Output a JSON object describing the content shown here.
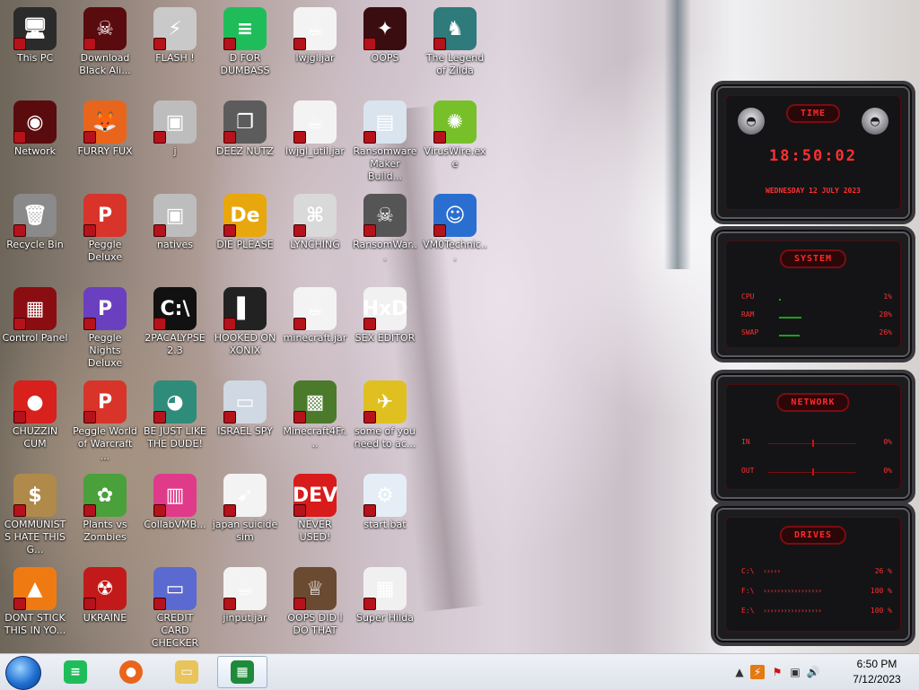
{
  "desktop": {
    "icons": [
      {
        "label": "This PC",
        "glyph": "🖥",
        "bg": "#2b2b2b"
      },
      {
        "label": "Download Black Ali...",
        "glyph": "☠",
        "bg": "#5a0b0e"
      },
      {
        "label": "FLASH !",
        "glyph": "⚡",
        "bg": "#c9c9c9"
      },
      {
        "label": "D FOR DUMBASS",
        "glyph": "≡",
        "bg": "#1fbd5a"
      },
      {
        "label": "lwjgl.jar",
        "glyph": "☕",
        "bg": "#f3f3f3"
      },
      {
        "label": "OOPS",
        "glyph": "✦",
        "bg": "#3a0d10"
      },
      {
        "label": "The Legend of Zilda",
        "glyph": "♞",
        "bg": "#2f7a7a"
      },
      {
        "label": "Network",
        "glyph": "◉",
        "bg": "#5a0b0e"
      },
      {
        "label": "FURRY FUX",
        "glyph": "🦊",
        "bg": "#e9651b"
      },
      {
        "label": "j",
        "glyph": "▣",
        "bg": "#bdbdbd"
      },
      {
        "label": "DEEZ NUTZ",
        "glyph": "❐",
        "bg": "#5c5c5c"
      },
      {
        "label": "lwjgl_util.jar",
        "glyph": "☕",
        "bg": "#f3f3f3"
      },
      {
        "label": "Ransomware Maker Build...",
        "glyph": "▤",
        "bg": "#d9e4ef"
      },
      {
        "label": "VirusWire.exe",
        "glyph": "✺",
        "bg": "#78c02a"
      },
      {
        "label": "Recycle Bin",
        "glyph": "🗑",
        "bg": "#8a8a8a"
      },
      {
        "label": "Peggle Deluxe",
        "glyph": "P",
        "bg": "#d8342a"
      },
      {
        "label": "natives",
        "glyph": "▣",
        "bg": "#bdbdbd"
      },
      {
        "label": "DIE PLEASE",
        "glyph": "De",
        "bg": "#e8a70c"
      },
      {
        "label": "LYNCHING",
        "glyph": "⌘",
        "bg": "#d9d9d9"
      },
      {
        "label": "RansomWar...",
        "glyph": "☠",
        "bg": "#555"
      },
      {
        "label": "VM0Technic...",
        "glyph": "☺",
        "bg": "#2a6fd0"
      },
      {
        "label": "Control Panel",
        "glyph": "▦",
        "bg": "#8a0d12"
      },
      {
        "label": "Peggle Nights Deluxe",
        "glyph": "P",
        "bg": "#6a3fc0"
      },
      {
        "label": "2PACALYPSE 2.3",
        "glyph": "C:\\",
        "bg": "#111"
      },
      {
        "label": "HOOKED ON XONIX",
        "glyph": "▌",
        "bg": "#222"
      },
      {
        "label": "minecraft.jar",
        "glyph": "☕",
        "bg": "#f3f3f3"
      },
      {
        "label": "SEX EDITOR",
        "glyph": "HxD",
        "bg": "#f1f1f1"
      },
      {
        "label": "CHUZZIN CUM",
        "glyph": "●",
        "bg": "#d8201c"
      },
      {
        "label": "Peggle World of Warcraft ...",
        "glyph": "P",
        "bg": "#d8342a"
      },
      {
        "label": "BE JUST LIKE THE DUDE!",
        "glyph": "◕",
        "bg": "#2f8c7a"
      },
      {
        "label": "ISRAEL SPY",
        "glyph": "▭",
        "bg": "#cfd8e3"
      },
      {
        "label": "Minecraft4Fr...",
        "glyph": "▩",
        "bg": "#4a7a2a"
      },
      {
        "label": "some of you need to ac...",
        "glyph": "✈",
        "bg": "#e0c020"
      },
      {
        "label": "COMMUNISTS HATE THIS G...",
        "glyph": "$",
        "bg": "#b08a4a"
      },
      {
        "label": "Plants vs Zombies",
        "glyph": "✿",
        "bg": "#4aa03a"
      },
      {
        "label": "CollabVMB...",
        "glyph": "▥",
        "bg": "#e03a8a"
      },
      {
        "label": "japan suicide sim",
        "glyph": "➹",
        "bg": "#f3f3f3"
      },
      {
        "label": "NEVER USED!",
        "glyph": "DEV",
        "bg": "#d81b1b"
      },
      {
        "label": "start.bat",
        "glyph": "⚙",
        "bg": "#e5eef7"
      },
      {
        "label": "DONT STICK THIS IN YO...",
        "glyph": "▲",
        "bg": "#f07a12"
      },
      {
        "label": "UKRAINE",
        "glyph": "☢",
        "bg": "#c21a1a"
      },
      {
        "label": "CREDIT CARD CHECKER",
        "glyph": "▭",
        "bg": "#5a6ad0"
      },
      {
        "label": "jinput.jar",
        "glyph": "☕",
        "bg": "#f3f3f3"
      },
      {
        "label": "OOPS DID I DO THAT",
        "glyph": "♕",
        "bg": "#6a4a30"
      },
      {
        "label": "Super Hilda",
        "glyph": "▦",
        "bg": "#f0f0f0"
      }
    ]
  },
  "gadgets": {
    "time": {
      "title": "TIME",
      "clock": "18:50:02",
      "date": "WEDNESDAY 12 JULY 2023"
    },
    "system": {
      "title": "SYSTEM",
      "rows": [
        {
          "label": "CPU",
          "value": "1%",
          "fill": 0.01
        },
        {
          "label": "RAM",
          "value": "28%",
          "fill": 0.28
        },
        {
          "label": "SWAP",
          "value": "26%",
          "fill": 0.26
        }
      ]
    },
    "network": {
      "title": "NETWORK",
      "rows": [
        {
          "label": "IN",
          "value": "0%"
        },
        {
          "label": "OUT",
          "value": "0%"
        }
      ]
    },
    "drives": {
      "title": "DRIVES",
      "rows": [
        {
          "label": "C:\\",
          "value": "26 %"
        },
        {
          "label": "F:\\",
          "value": "100 %"
        },
        {
          "label": "E:\\",
          "value": "100 %"
        }
      ]
    }
  },
  "taskbar": {
    "apps": [
      {
        "name": "spotify",
        "glyph": "≡",
        "bg": "#1fbd5a"
      },
      {
        "name": "firefox",
        "glyph": "●",
        "bg": "#e9651b"
      },
      {
        "name": "explorer",
        "glyph": "▭",
        "bg": "#e8c45a"
      },
      {
        "name": "calculator",
        "glyph": "▦",
        "bg": "#1f8a3a"
      }
    ],
    "clock": {
      "time": "6:50 PM",
      "date": "7/12/2023"
    }
  }
}
